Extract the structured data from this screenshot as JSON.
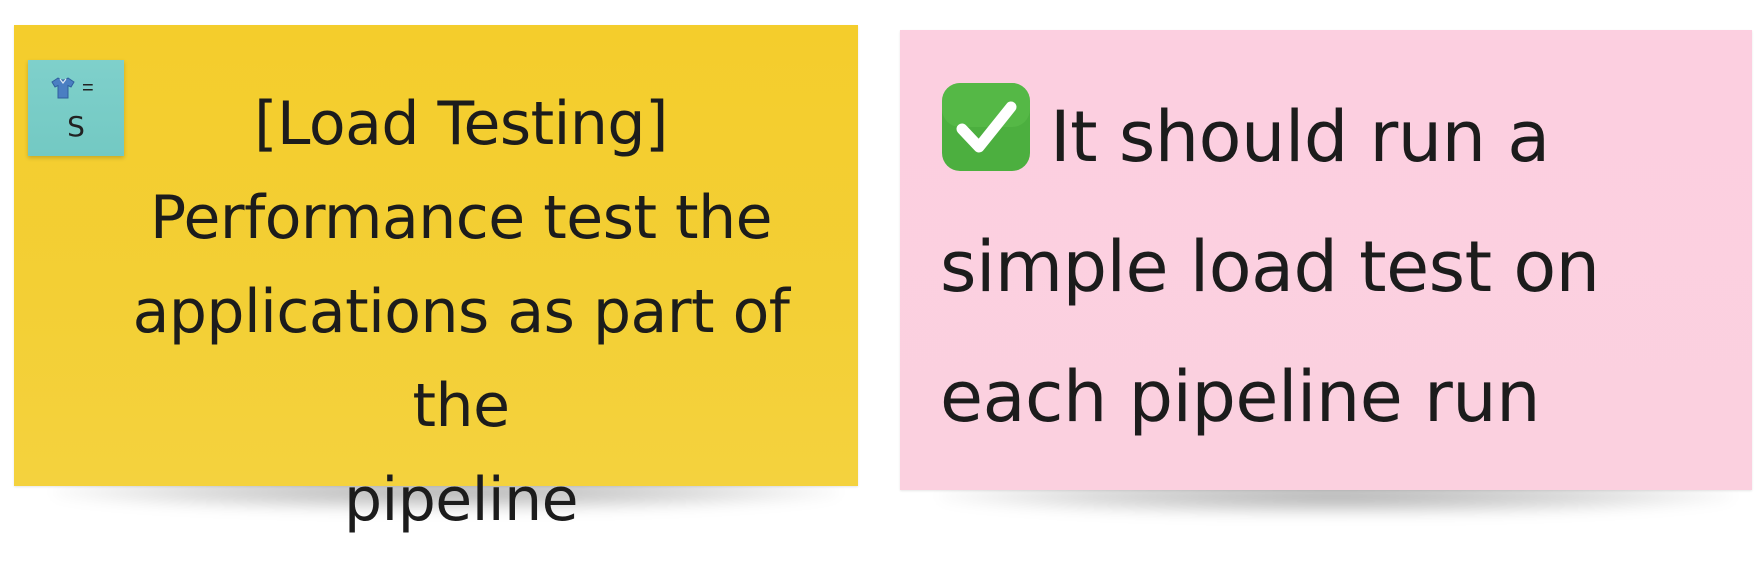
{
  "board": {
    "notes": [
      {
        "color": "#f4cd2c",
        "estimate_tag": {
          "icon": "shirt-icon",
          "equals": "=",
          "size": "S",
          "color": "#7fd0cb"
        },
        "lines": [
          "[Load Testing]",
          "Performance test the",
          "applications as part of the",
          "pipeline"
        ]
      },
      {
        "color": "#fccfe0",
        "icon": "check-icon",
        "icon_color": "#4caf3f",
        "lines": [
          "It should run a",
          "simple load test on",
          "each pipeline run"
        ]
      }
    ]
  }
}
